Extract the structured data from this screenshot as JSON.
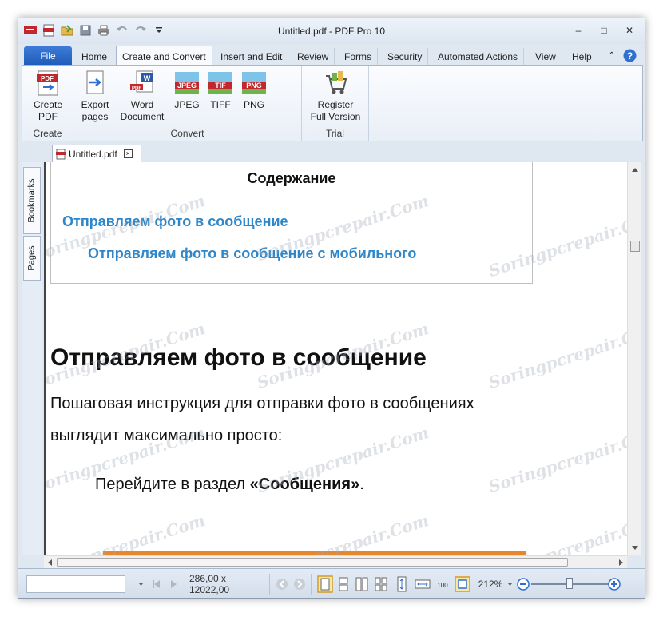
{
  "window": {
    "title": "Untitled.pdf - PDF Pro 10"
  },
  "quick_access": {
    "icons": [
      "app-menu-icon",
      "pdf-icon",
      "open-folder-icon",
      "save-icon",
      "print-icon",
      "undo-icon",
      "redo-icon",
      "customize-dropdown-icon"
    ]
  },
  "window_controls": {
    "minimize": "‒",
    "maximize": "□",
    "close": "✕"
  },
  "ribbon_tabs": {
    "file": "File",
    "tabs": [
      "Home",
      "Create and Convert",
      "Insert and Edit",
      "Review",
      "Forms",
      "Security",
      "Automated Actions",
      "View",
      "Help"
    ],
    "active": "Create and Convert"
  },
  "ribbon": {
    "groups": {
      "create": {
        "label": "Create",
        "buttons": [
          {
            "label_line1": "Create",
            "label_line2": "PDF",
            "icon": "create-pdf-icon"
          }
        ]
      },
      "convert": {
        "label": "Convert",
        "buttons": [
          {
            "label_line1": "Export",
            "label_line2": "pages",
            "icon": "export-pages-icon"
          },
          {
            "label_line1": "Word",
            "label_line2": "Document",
            "icon": "word-icon"
          },
          {
            "label_line1": "JPEG",
            "label_line2": "",
            "icon": "jpeg-icon",
            "badge": "JPEG"
          },
          {
            "label_line1": "TIFF",
            "label_line2": "",
            "icon": "tiff-icon",
            "badge": "TIF"
          },
          {
            "label_line1": "PNG",
            "label_line2": "",
            "icon": "png-icon",
            "badge": "PNG"
          }
        ]
      },
      "trial": {
        "label": "Trial",
        "buttons": [
          {
            "label_line1": "Register",
            "label_line2": "Full Version",
            "icon": "cart-icon"
          }
        ]
      }
    }
  },
  "document_tab": {
    "name": "Untitled.pdf",
    "close": "×"
  },
  "side_panel": {
    "tabs": [
      "Bookmarks",
      "Pages"
    ]
  },
  "document": {
    "toc_title": "Содержание",
    "toc_links": [
      "Отправляем фото в сообщение",
      "Отправляем фото в сообщение с мобильного"
    ],
    "heading": "Отправляем фото в сообщение",
    "paragraph": "Пошаговая инструкция для отправки фото в сообщениях выглядит максимально просто:",
    "bullet_prefix": "Перейдите в раздел ",
    "bullet_bold": "«Сообщения»",
    "bullet_suffix": "."
  },
  "status_bar": {
    "page_size": "286,00 x 12022,00",
    "zoom_percent": "212%",
    "zoom_level": 0.48,
    "zoom_minus": "−",
    "zoom_plus": "+"
  },
  "watermark_text": "Soringpcrepair.Com",
  "colors": {
    "file_tab": "#1f5bb8",
    "link": "#2f86c8",
    "accent_orange": "#e8862a"
  }
}
